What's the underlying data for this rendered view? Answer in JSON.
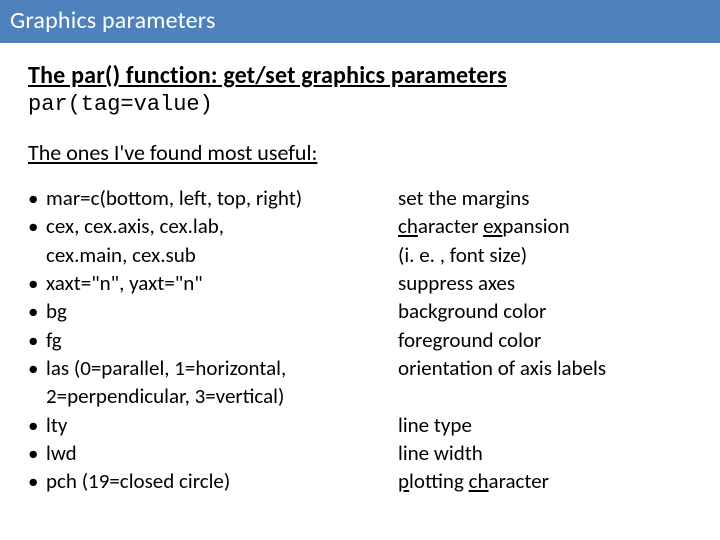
{
  "title": "Graphics parameters",
  "heading": "The par() function: get/set graphics parameters",
  "code": "par(tag=value)",
  "subhead": "The ones I've found most useful:",
  "left": {
    "b1": "mar=c(bottom, left, top, right)",
    "b2": "cex, cex.axis, cex.lab,",
    "b2c": "cex.main, cex.sub",
    "b3": "xaxt=\"n\", yaxt=\"n\"",
    "b4": "bg",
    "b5": "fg",
    "b6": "las (0=parallel, 1=horizontal,",
    "b6c": "2=perpendicular, 3=vertical)",
    "b7": "lty",
    "b8": "lwd",
    "b9": "pch (19=closed circle)"
  },
  "right": {
    "d1": "set the margins",
    "d2a": "ch",
    "d2b": "aracter ",
    "d2c": "ex",
    "d2d": "pansion",
    "d2e": "(i. e. , font size)",
    "d3": "suppress axes",
    "d4": "background color",
    "d5": "foreground color",
    "d6": "orientation of axis labels",
    "d7": "line type",
    "d8": "line width",
    "d9a": "p",
    "d9b": "lotting ",
    "d9c": "ch",
    "d9d": "aracter"
  }
}
